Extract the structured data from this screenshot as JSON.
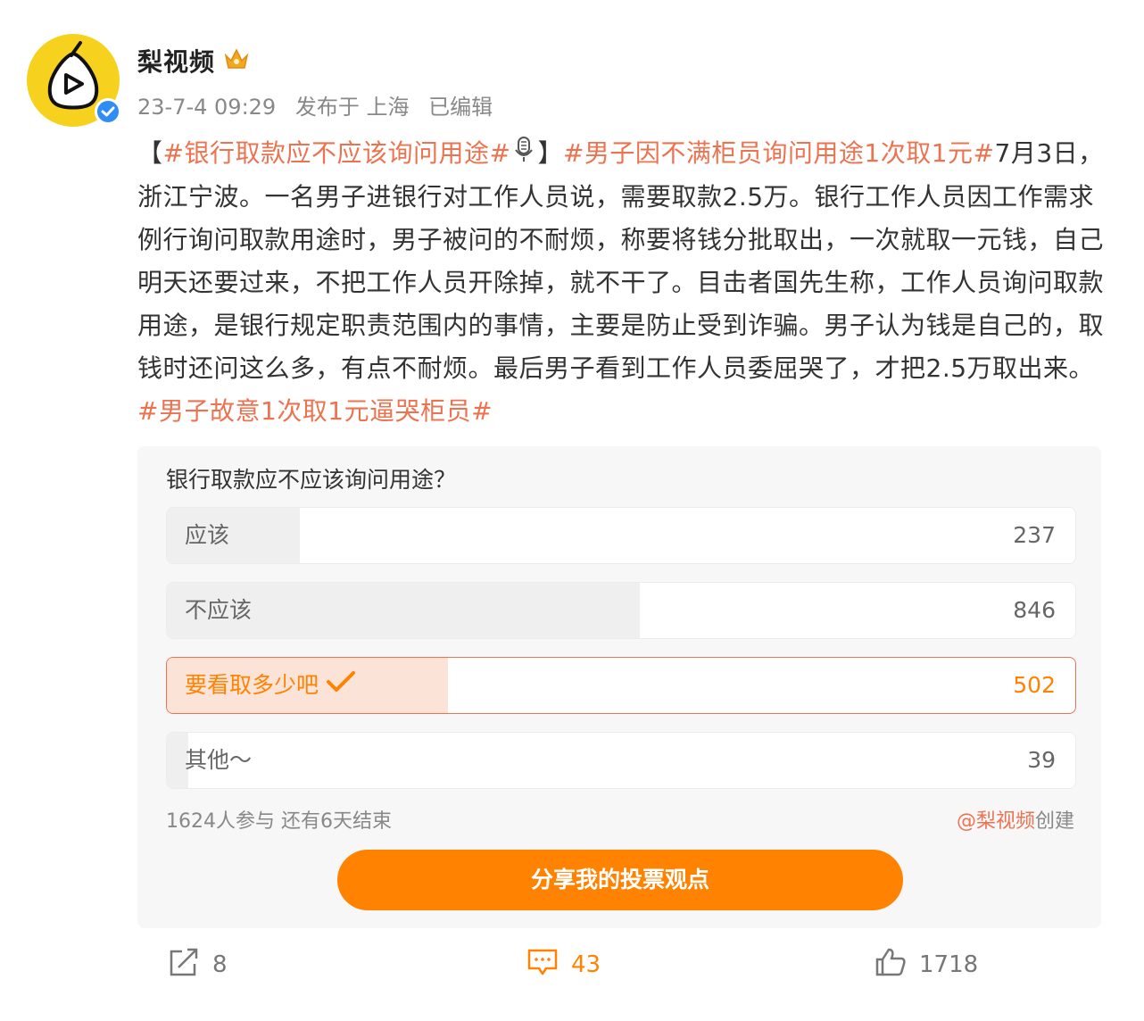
{
  "post": {
    "author": "梨视频",
    "time": "23-7-4 09:29",
    "location": "发布于 上海",
    "edited": "已编辑",
    "content": {
      "bracket_open": "【",
      "tag1": "#银行取款应不应该询问用途#",
      "bracket_close": "】",
      "tag2": "#男子因不满柜员询问用途1次取1元#",
      "body": "7月3日，浙江宁波。一名男子进银行对工作人员说，需要取款2.5万。银行工作人员因工作需求例行询问取款用途时，男子被问的不耐烦，称要将钱分批取出，一次就取一元钱，自己明天还要过来，不把工作人员开除掉，就不干了。目击者国先生称，工作人员询问取款用途，是银行规定职责范围内的事情，主要是防止受到诈骗。男子认为钱是自己的，取钱时还问这么多，有点不耐烦。最后男子看到工作人员委屈哭了，才把2.5万取出来。",
      "tag3": "#男子故意1次取1元逼哭柜员#"
    }
  },
  "poll": {
    "question": "银行取款应不应该询问用途？",
    "options": [
      {
        "label": "应该",
        "count": "237",
        "share": 0.146
      },
      {
        "label": "不应该",
        "count": "846",
        "share": 0.521
      },
      {
        "label": "要看取多少吧",
        "count": "502",
        "share": 0.309,
        "selected": true
      },
      {
        "label": "其他～",
        "count": "39",
        "share": 0.024
      }
    ],
    "participants": "1624人参与 还有6天结束",
    "creator_handle": "@梨视频",
    "creator_suffix": "创建",
    "share_button": "分享我的投票观点"
  },
  "actions": {
    "repost": "8",
    "comment": "43",
    "like": "1718"
  },
  "colors": {
    "tag": "#eb7350",
    "accent": "#ff8200",
    "verified": "#2f8ef5",
    "avatar_bg": "#f6d21f"
  },
  "icons": [
    "avatar-logo-icon",
    "verified-icon",
    "crown-icon",
    "microphone-icon",
    "checkmark-icon",
    "repost-icon",
    "comment-icon",
    "like-icon"
  ]
}
